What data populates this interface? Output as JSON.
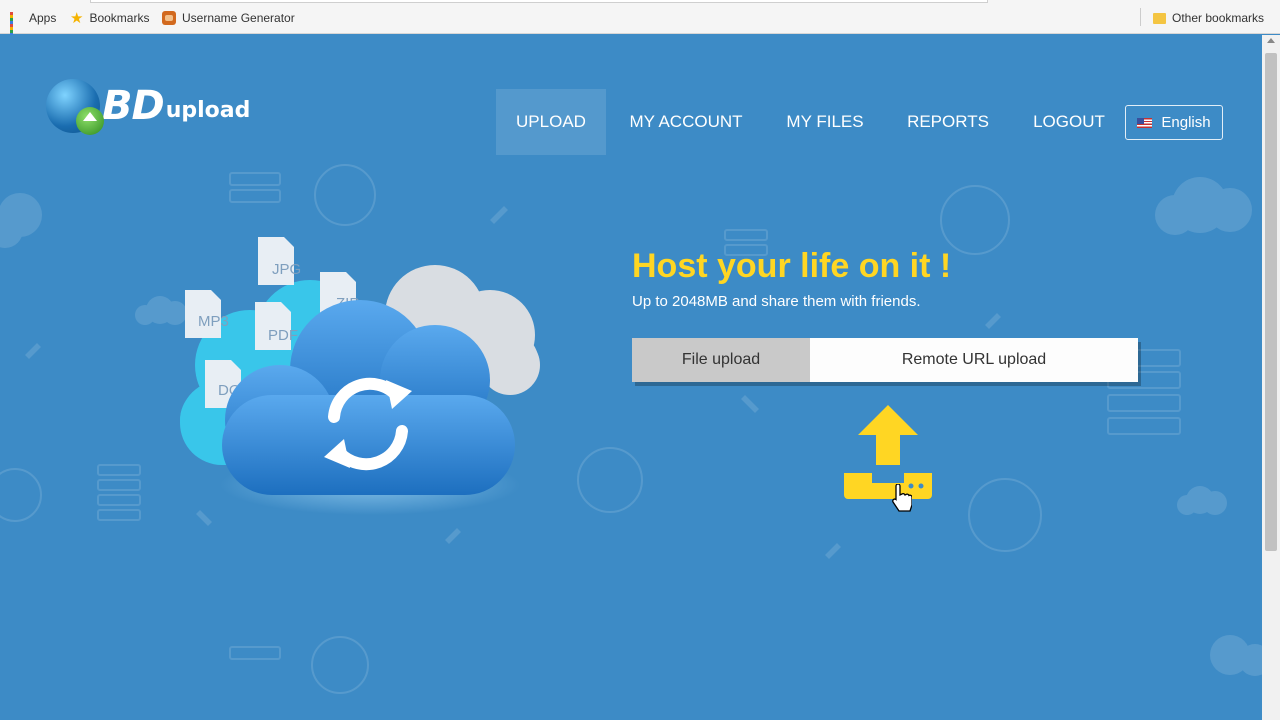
{
  "bookmarks_bar": {
    "apps_label": "Apps",
    "bookmarks_label": "Bookmarks",
    "username_generator_label": "Username Generator",
    "other_bookmarks_label": "Other bookmarks"
  },
  "logo": {
    "bd": "BD",
    "upload": "upload"
  },
  "nav": {
    "upload": "UPLOAD",
    "my_account": "MY ACCOUNT",
    "my_files": "MY FILES",
    "reports": "REPORTS",
    "logout": "LOGOUT",
    "language": "English"
  },
  "hero": {
    "title": "Host your life on it !",
    "subtitle": "Up to 2048MB and share them with friends."
  },
  "upload_tabs": {
    "file_upload": "File upload",
    "remote_url_upload": "Remote URL upload"
  },
  "illustration": {
    "file_types": [
      "JPG",
      "ZIP",
      "MP3",
      "PDF",
      "DOC"
    ]
  },
  "colors": {
    "page_background": "#3d8bc6",
    "accent_yellow": "#ffd623",
    "cloud_blue": "#2a7cc7",
    "cloud_cyan": "#39c6ea"
  }
}
